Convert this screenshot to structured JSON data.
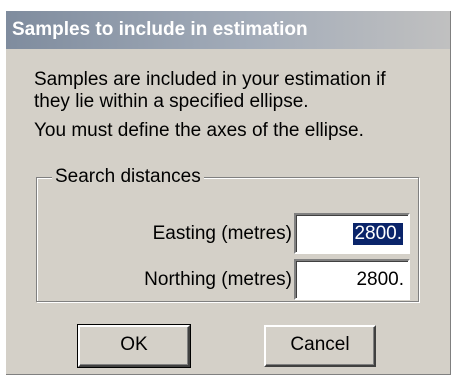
{
  "dialog": {
    "title": "Samples to include in estimation",
    "description_line1": "Samples are included in your estimation if",
    "description_line2": "they lie within a specified ellipse.",
    "description_line3": "You must define the axes of the ellipse."
  },
  "search_distances": {
    "group_label": "Search distances",
    "easting_label": "Easting (metres)",
    "easting_value": "2800.",
    "northing_label": "Northing (metres)",
    "northing_value": "2800."
  },
  "buttons": {
    "ok_label": "OK",
    "cancel_label": "Cancel"
  },
  "colors": {
    "title_gradient_start": "#7f8c9e",
    "dialog_background": "#d4d0c8",
    "selection_highlight": "#0a246a"
  }
}
